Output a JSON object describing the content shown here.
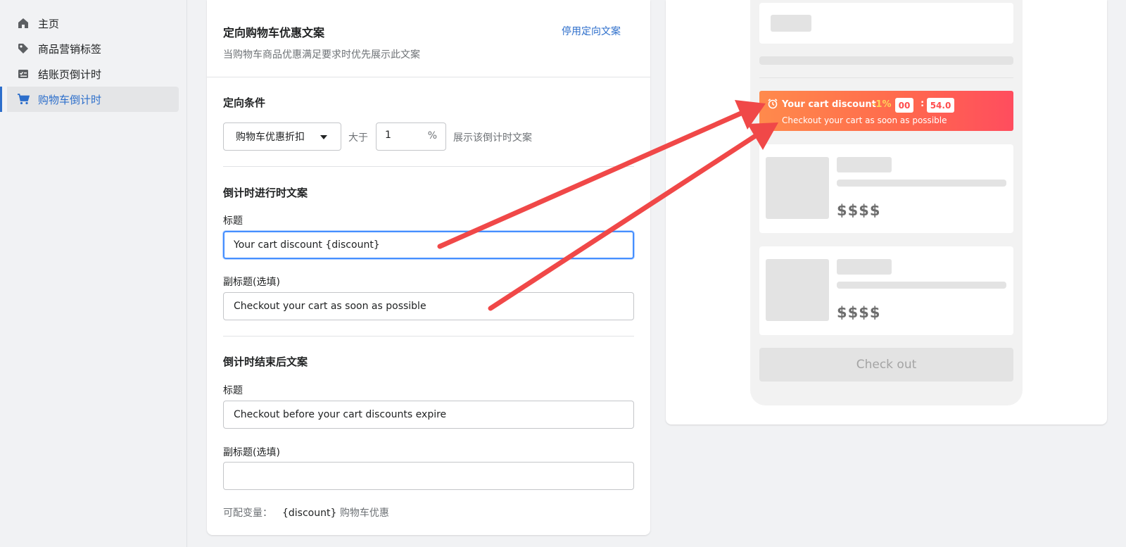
{
  "sidebar": {
    "items": [
      {
        "label": "主页",
        "icon": "home-icon"
      },
      {
        "label": "商品营销标签",
        "icon": "tag-icon"
      },
      {
        "label": "结账页倒计时",
        "icon": "checklist-icon"
      },
      {
        "label": "购物车倒计时",
        "icon": "cart-icon",
        "active": true
      }
    ]
  },
  "settings": {
    "title": "定向购物车优惠文案",
    "description": "当购物车商品优惠满足要求时优先展示此文案",
    "disable_link": "停用定向文案",
    "condition": {
      "heading": "定向条件",
      "select_value": "购物车优惠折扣",
      "gt_label": "大于",
      "threshold_value": "1",
      "unit": "%",
      "suffix_label": "展示该倒计时文案"
    },
    "running": {
      "heading": "倒计时进行时文案",
      "title_label": "标题",
      "title_value": "Your cart discount {discount}",
      "subtitle_label": "副标题(选填)",
      "subtitle_value": "Checkout your cart as soon as possible"
    },
    "ended": {
      "heading": "倒计时结束后文案",
      "title_label": "标题",
      "title_value": "Checkout before your cart discounts expire",
      "subtitle_label": "副标题(选填)",
      "subtitle_value": ""
    },
    "variables": {
      "label": "可配变量：",
      "name": "{discount}",
      "desc": "购物车优惠"
    }
  },
  "preview": {
    "banner": {
      "title": "Your cart discount",
      "discount": "-1%",
      "minutes": "00",
      "separator": ":",
      "seconds": "54.0",
      "subtitle": "Checkout your cart as soon as possible"
    },
    "products": [
      {
        "price": "$$$$"
      },
      {
        "price": "$$$$"
      }
    ],
    "checkout_label": "Check out"
  },
  "colors": {
    "accent": "#2c6ecb",
    "banner_start": "#ff8a4c",
    "banner_end": "#ff4d5e",
    "arrow": "#f04848"
  }
}
